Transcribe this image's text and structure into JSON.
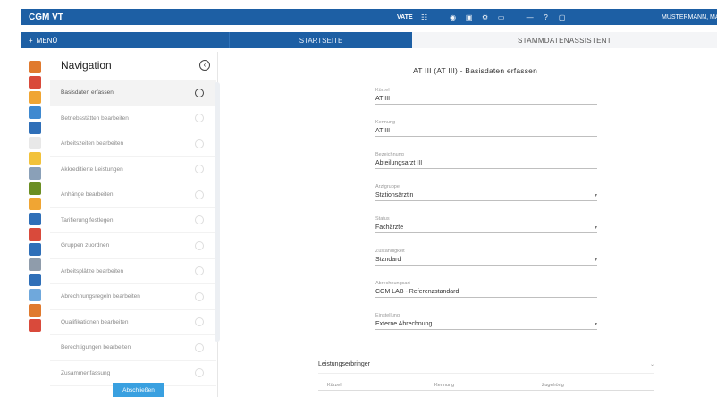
{
  "app": {
    "brand": "CGM VT"
  },
  "topbar": {
    "user_short": "VATE",
    "icons": [
      "grid-icon",
      "eye-icon",
      "window-icon",
      "gear-icon",
      "camera-icon",
      "minus-icon",
      "help-icon",
      "monitor-icon"
    ],
    "icon_glyphs": [
      "☷",
      "◉",
      "▣",
      "⚙",
      "▭",
      "—",
      "?",
      "▢"
    ],
    "username": "MUSTERMANN, MAX"
  },
  "tabs": {
    "menu_label": "MENÜ",
    "start_label": "STARTSEITE",
    "wizard_label": "STAMMDATENASSISTENT"
  },
  "iconstrip": {
    "colors": [
      "#e07a2e",
      "#d94a3b",
      "#f0a533",
      "#3f89d0",
      "#2f6fb8",
      "#e8e8e8",
      "#f2c23a",
      "#8aa0b8",
      "#6b8e23",
      "#f0a533",
      "#2f6fb8",
      "#d94a3b",
      "#2f6fb8",
      "#8f9cab",
      "#2f6fb8",
      "#6fa8dc",
      "#e07a2e",
      "#d94a3b"
    ]
  },
  "navigation": {
    "title": "Navigation",
    "items": [
      "Basisdaten erfassen",
      "Betriebsstätten bearbeiten",
      "Arbeitszeiten bearbeiten",
      "Akkreditierte Leistungen",
      "Anhänge bearbeiten",
      "Tarifierung festlegen",
      "Gruppen zuordnen",
      "Arbeitsplätze bearbeiten",
      "Abrechnungsregeln bearbeiten",
      "Qualifikationen bearbeiten",
      "Berechtigungen bearbeiten",
      "Zusammenfassung"
    ],
    "button_label": "Abschließen"
  },
  "form": {
    "title": "AT III (AT III) - Basisdaten erfassen",
    "fields": [
      {
        "label": "Kürzel",
        "value": "AT III",
        "dropdown": false
      },
      {
        "label": "Kennung",
        "value": "AT III",
        "dropdown": false
      },
      {
        "label": "Bezeichnung",
        "value": "Abteilungsarzt III",
        "dropdown": false
      },
      {
        "label": "Arztgruppe",
        "value": "Stationsärztin",
        "dropdown": true
      },
      {
        "label": "Status",
        "value": "Fachärzte",
        "dropdown": true
      },
      {
        "label": "Zuständigkeit",
        "value": "Standard",
        "dropdown": true
      },
      {
        "label": "Abrechnungsart",
        "value": "CGM LAB - Referenzstandard",
        "dropdown": false
      },
      {
        "label": "Einstellung",
        "value": "Externe Abrechnung",
        "dropdown": true
      }
    ],
    "section": {
      "title": "Leistungserbringer",
      "columns": [
        "Kürzel",
        "Kennung",
        "Zugehörig"
      ]
    }
  }
}
